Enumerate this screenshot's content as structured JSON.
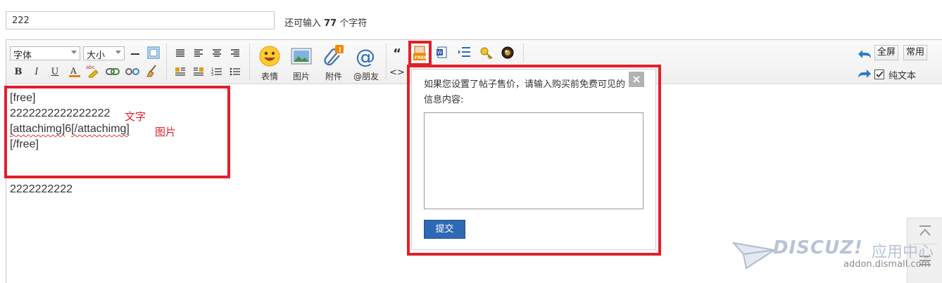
{
  "subject": {
    "value": "222"
  },
  "char_hint": {
    "prefix": "还可输入 ",
    "count": "77",
    "suffix": " 个字符"
  },
  "toolbar": {
    "font_select": "字体",
    "size_select": "大小",
    "big_buttons": [
      {
        "label": "表情",
        "icon": "smiley-icon"
      },
      {
        "label": "图片",
        "icon": "image-icon"
      },
      {
        "label": "附件",
        "icon": "paperclip-icon"
      },
      {
        "label": "@朋友",
        "icon": "at-icon"
      }
    ],
    "quote_glyph": "“",
    "code_glyph": "<>",
    "fullscreen": "全屏",
    "common": "常用",
    "plain_text": "纯文本"
  },
  "content": {
    "line1": "[free]",
    "line2": "2222222222222222",
    "line3_tag_open": "[attachimg]",
    "line3_value": "6",
    "line3_tag_close": "[/attachimg]",
    "line4": "[/free]",
    "line5": "2222222222",
    "annot_text": "文字",
    "annot_image": "图片"
  },
  "popup": {
    "message": "如果您设置了帖子售价，请输入购买前免费可见的信息内容:",
    "close": "×",
    "textarea_value": "",
    "submit": "提交"
  },
  "watermark": {
    "brand": "DISCUZ!",
    "cn": "应用中心",
    "url": "addon.dismall.com"
  },
  "colors": {
    "annotation_red": "#e0202a",
    "submit_blue": "#2f68b4"
  }
}
